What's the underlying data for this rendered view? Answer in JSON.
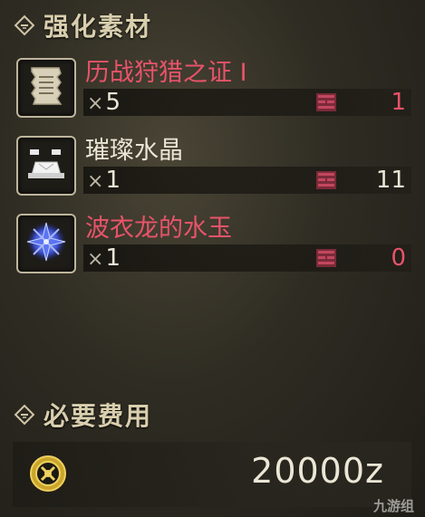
{
  "sections": {
    "materials_title": "强化素材",
    "cost_title": "必要费用"
  },
  "materials": [
    {
      "name": "历战狩猎之证 I",
      "qty_prefix": "×",
      "qty": "5",
      "stock": "1",
      "name_color": "#e8536a",
      "stock_color": "#e8536a",
      "icon": "scroll-icon"
    },
    {
      "name": "璀璨水晶",
      "qty_prefix": "×",
      "qty": "1",
      "stock": "11",
      "name_color": "#ece6d6",
      "stock_color": "#ece6d6",
      "icon": "crystal-ore-icon"
    },
    {
      "name": "波衣龙的水玉",
      "qty_prefix": "×",
      "qty": "1",
      "stock": "0",
      "name_color": "#e8536a",
      "stock_color": "#e8536a",
      "icon": "blue-gem-icon"
    }
  ],
  "cost": {
    "value": "20000z",
    "icon": "zenny-coin-icon"
  },
  "watermark": "九游组",
  "colors": {
    "warning_red": "#e8536a",
    "title_gold": "#d9cfae",
    "box_pink": "#c2475e"
  }
}
